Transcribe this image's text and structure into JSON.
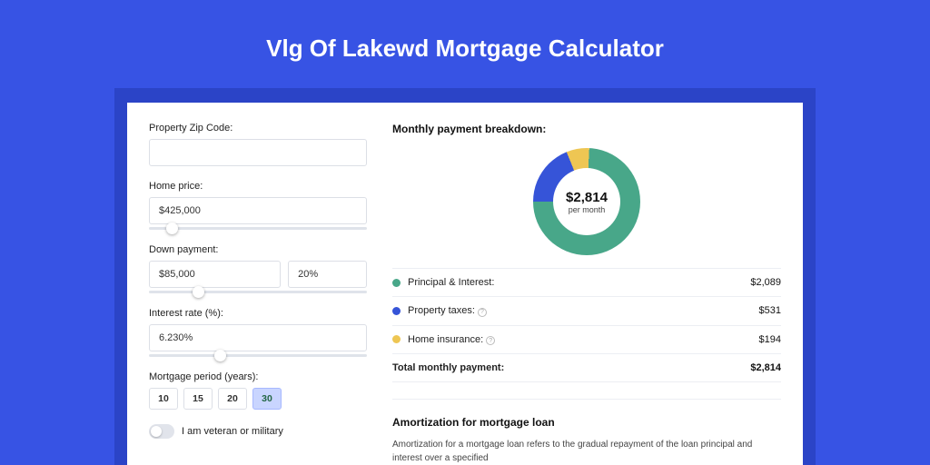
{
  "page": {
    "title": "Vlg Of Lakewd Mortgage Calculator"
  },
  "form": {
    "zip_label": "Property Zip Code:",
    "zip_value": "",
    "home_price_label": "Home price:",
    "home_price_value": "$425,000",
    "home_price_slider_pct": 8,
    "down_payment_label": "Down payment:",
    "down_payment_value": "$85,000",
    "down_payment_pct_value": "20%",
    "down_payment_slider_pct": 20,
    "interest_label": "Interest rate (%):",
    "interest_value": "6.230%",
    "interest_slider_pct": 30,
    "period_label": "Mortgage period (years):",
    "period_options": [
      "10",
      "15",
      "20",
      "30"
    ],
    "period_selected_index": 3,
    "veteran_label": "I am veteran or military",
    "veteran_on": false
  },
  "breakdown": {
    "title": "Monthly payment breakdown:",
    "center_amount": "$2,814",
    "center_sub": "per month",
    "items": [
      {
        "label": "Principal & Interest:",
        "value": "$2,089",
        "color": "#48a789",
        "info": false
      },
      {
        "label": "Property taxes:",
        "value": "$531",
        "color": "#3654d8",
        "info": true
      },
      {
        "label": "Home insurance:",
        "value": "$194",
        "color": "#eec653",
        "info": true
      }
    ],
    "total_label": "Total monthly payment:",
    "total_value": "$2,814"
  },
  "chart_data": {
    "type": "pie",
    "title": "Monthly payment breakdown:",
    "series": [
      {
        "name": "Principal & Interest",
        "value": 2089,
        "color": "#48a789"
      },
      {
        "name": "Property taxes",
        "value": 531,
        "color": "#3654d8"
      },
      {
        "name": "Home insurance",
        "value": 194,
        "color": "#eec653"
      }
    ],
    "total": 2814,
    "center_label": "$2,814 per month"
  },
  "amortization": {
    "title": "Amortization for mortgage loan",
    "text": "Amortization for a mortgage loan refers to the gradual repayment of the loan principal and interest over a specified"
  }
}
